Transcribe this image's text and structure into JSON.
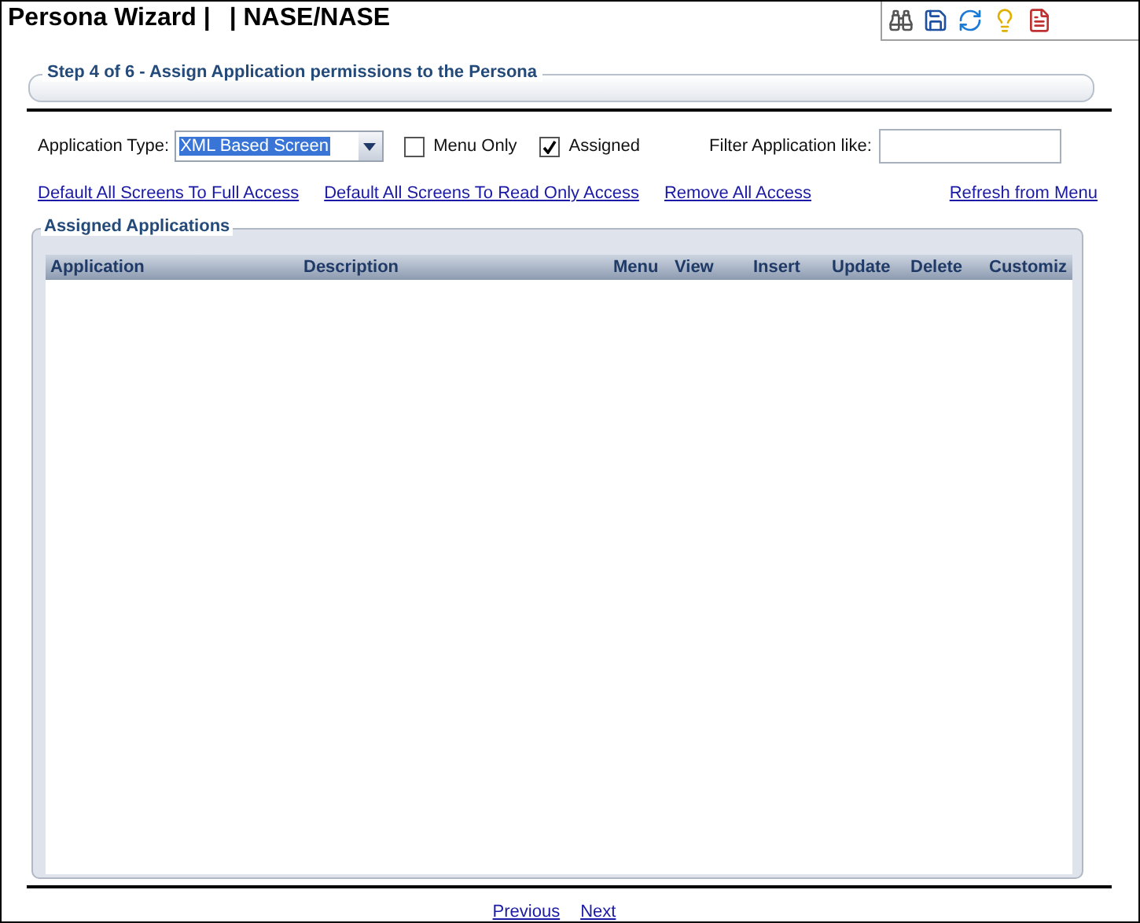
{
  "header": {
    "title": "Persona Wizard |",
    "context": "| NASE/NASE"
  },
  "toolbar": [
    {
      "kind": "find"
    },
    {
      "kind": "save"
    },
    {
      "kind": "refresh"
    },
    {
      "kind": "hint"
    },
    {
      "kind": "report"
    }
  ],
  "step": {
    "title": "Step 4 of 6 - Assign Application permissions to the Persona"
  },
  "filters": {
    "type_label": "Application Type:",
    "type_value": "XML Based Screen",
    "menu_only": {
      "label": "Menu Only",
      "checked": false
    },
    "assigned": {
      "label": "Assigned",
      "checked": true
    },
    "filter_label": "Filter Application like:"
  },
  "links": [
    "Default All Screens To Full Access",
    "Default All Screens To Read Only Access",
    "Remove All Access",
    "Refresh from Menu"
  ],
  "assigned_applications": {
    "title": "Assigned Applications",
    "columns": [
      "Application",
      "Description",
      "Menu",
      "View",
      "Insert",
      "Update",
      "Delete",
      "Customiz"
    ]
  },
  "footer": {
    "previous": "Previous",
    "next": "Next"
  }
}
